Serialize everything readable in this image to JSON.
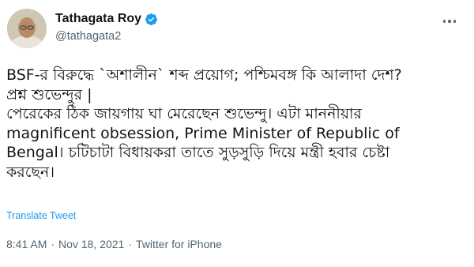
{
  "author": {
    "name": "Tathagata Roy",
    "handle": "@tathagata2",
    "verified_color": "#1d9bf0"
  },
  "tweet": {
    "lines": [
      "BSF-র বিরুদ্ধে `অশালীন` শব্দ প্রয়োগ; পশ্চিমবঙ্গ কি আলাদা দেশ?",
      "প্রশ্ন শুভেন্দুর |",
      "পেরেকের ঠিক জায়গায় ঘা মেরেছেন শুভেন্দু। এটা মাননীয়ার",
      "magnificent obsession, Prime Minister of Republic of",
      "Bengal। চটিচাটা বিধায়করা তাতে সুড়সুড়ি দিয়ে মন্ত্রী হবার চেষ্টা",
      "করছেন।"
    ],
    "translate_label": "Translate Tweet",
    "time": "8:41 AM",
    "separator": "·",
    "date": "Nov 18, 2021",
    "source": "Twitter for iPhone"
  },
  "colors": {
    "link": "#1d9bf0",
    "secondary": "#536471",
    "text": "#0f1419"
  },
  "icons": {
    "verified": "verified-badge-icon",
    "more": "more-options-icon"
  }
}
